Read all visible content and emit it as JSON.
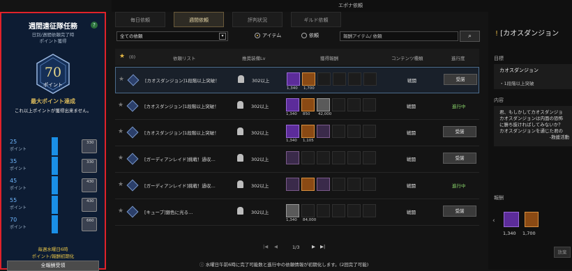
{
  "left": {
    "title": "週間遠征隊任務",
    "sub1": "日別/週間依頼完了時",
    "sub2": "ポイント獲得",
    "points": "70",
    "points_unit": "ポイント",
    "max_title": "最大ポイント達成",
    "max_desc": "これ以上ポイントが獲得出来ません。",
    "tiers": [
      {
        "n": "25",
        "u": "ポイント",
        "q": "330"
      },
      {
        "n": "35",
        "u": "ポイント",
        "q": "330"
      },
      {
        "n": "45",
        "u": "ポイント",
        "q": "430"
      },
      {
        "n": "55",
        "u": "ポイント",
        "q": "430"
      },
      {
        "n": "70",
        "u": "ポイント",
        "q": "660"
      }
    ],
    "note1": "毎週水曜日6時",
    "note2": "ポイント/報酬初期化",
    "claim": "全報酬受領"
  },
  "window_title": "エポナ依頼",
  "tabs": [
    "毎日依頼",
    "週間依頼",
    "評判状況",
    "ギルド依頼"
  ],
  "filter": {
    "select": "全ての依頼",
    "r1": "アイテム",
    "r2": "依頼",
    "search": "報酬アイテム/ 依頼",
    "count": "(0)"
  },
  "headers": {
    "h1": "依頼リスト",
    "h2": "推奨装備Lv",
    "h3": "獲得報酬",
    "h4": "コンテンツ種類",
    "h5": "進行度"
  },
  "rows": [
    {
      "name": "[カオスダンジョン]1段階以上突破！",
      "lv": "302以上",
      "q1": "1,340",
      "q2": "1,700",
      "q3": "",
      "type": "戦闘",
      "act": "受諾"
    },
    {
      "name": "[カオスダンジョン]1段階以上突破！",
      "lv": "302以上",
      "q1": "1,340",
      "q2": "850",
      "q3": "42,000",
      "type": "戦闘",
      "prog": "進行中"
    },
    {
      "name": "[カオスダンジョン]1段階以上突破！",
      "lv": "302以上",
      "q1": "1,340",
      "q2": "1,105",
      "q3": "",
      "type": "戦闘",
      "act": "受諾"
    },
    {
      "name": "[ガーディアンレイド]挑戦！過収…",
      "lv": "302以上",
      "q1": "",
      "q2": "",
      "q3": "",
      "type": "戦闘",
      "act": "受諾"
    },
    {
      "name": "[ガーディアンレイド]挑戦！過収…",
      "lv": "302以上",
      "q1": "",
      "q2": "",
      "q3": "",
      "type": "戦闘",
      "prog": "進行中"
    },
    {
      "name": "[キューブ]銀色に光る…",
      "lv": "302以上",
      "q1": "1,340",
      "q2": "84,000",
      "q3": "",
      "type": "戦闘",
      "act": "受諾"
    }
  ],
  "pager": "1/3",
  "footer": "水曜日午前6時に完了可能数と進行中の依頼情報が初期化します。(2回完了可能)",
  "right": {
    "title": "[カオスダンジョン",
    "l_goal": "目標",
    "goal_name": "カオスダンジョン",
    "goal_item": "・1段階以上突破",
    "l_desc": "内容",
    "desc": [
      "君、もしかしてカオスダンジョ",
      "カオスダンジョンは内面の恐怖",
      "に勝ち抜ければしてみないか？",
      "カオスダンジョンを通じた君の",
      "-救援活動"
    ],
    "l_reward": "報酬",
    "q1": "1,340",
    "q2": "1,700",
    "btn": "放棄"
  }
}
